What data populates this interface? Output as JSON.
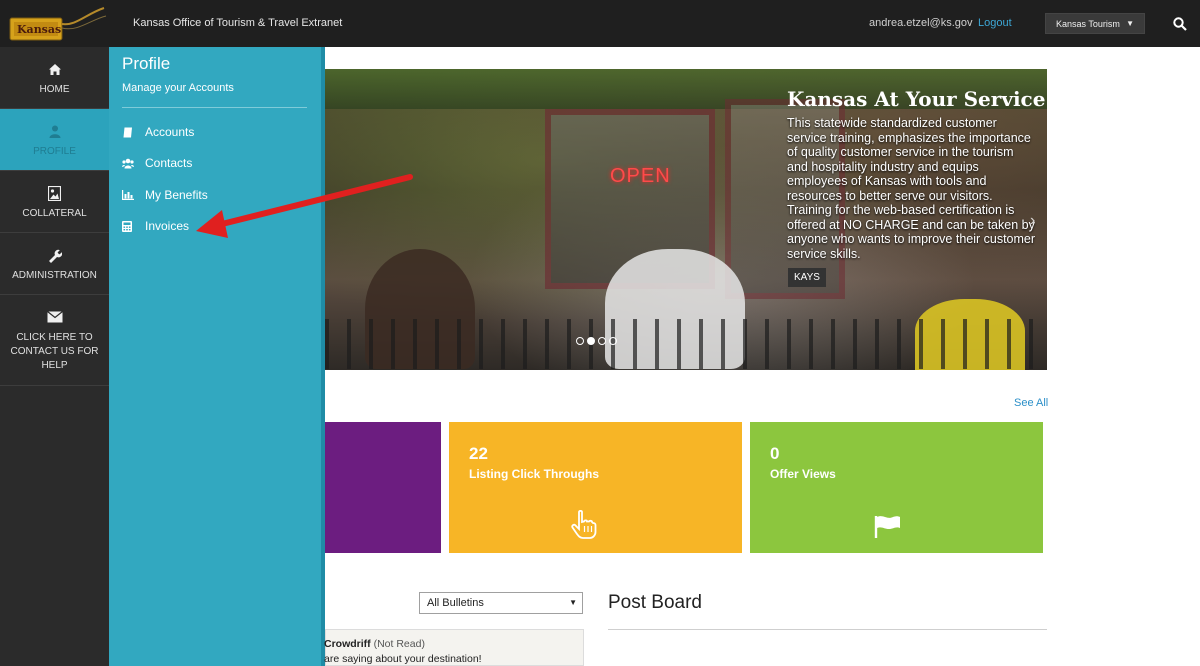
{
  "header": {
    "site_title": "Kansas Office of Tourism & Travel Extranet",
    "user_email": "andrea.etzel@ks.gov",
    "logout_label": "Logout",
    "account_selected": "Kansas Tourism",
    "logo_text": "Kansas"
  },
  "sidebar": {
    "items": [
      {
        "label": "HOME",
        "icon": "home-icon"
      },
      {
        "label": "PROFILE",
        "icon": "user-icon"
      },
      {
        "label": "COLLATERAL",
        "icon": "image-icon"
      },
      {
        "label": "ADMINISTRATION",
        "icon": "wrench-icon"
      },
      {
        "label": "CLICK HERE TO CONTACT US FOR HELP",
        "icon": "envelope-icon"
      }
    ]
  },
  "profile_panel": {
    "title": "Profile",
    "subtitle": "Manage your Accounts",
    "links": [
      {
        "label": "Accounts",
        "icon": "book-icon"
      },
      {
        "label": "Contacts",
        "icon": "users-icon"
      },
      {
        "label": "My Benefits",
        "icon": "bar-chart-icon"
      },
      {
        "label": "Invoices",
        "icon": "calculator-icon"
      }
    ]
  },
  "hero": {
    "title": "Kansas At Your Service",
    "body": "This statewide standardized customer service training, emphasizes the importance of quality customer service in the tourism and hospitality industry and equips employees of Kansas with tools and resources to better serve our visitors. Training for the web-based certification is offered at NO CHARGE and can be taken by anyone who wants to improve their customer service skills.",
    "tag": "KAYS",
    "sign_text": "OPEN",
    "slide_count": 4,
    "active_slide": 2
  },
  "stats": {
    "see_all": "See All",
    "tiles": [
      {
        "value": "22",
        "label": "Listing Click Throughs",
        "icon": "hand-pointer-icon",
        "color": "#f7b526"
      },
      {
        "value": "0",
        "label": "Offer Views",
        "icon": "flag-icon",
        "color": "#8cc63e"
      }
    ],
    "purple_tile_color": "#6c1d80"
  },
  "bulletins": {
    "filter_selected": "All Bulletins",
    "item_source": "Crowdriff",
    "item_state": "(Not Read)",
    "item_text": "are saying about your destination!"
  },
  "post_board": {
    "title": "Post Board"
  },
  "colors": {
    "panel": "#32a8c0",
    "topbar": "#1f1f1f",
    "sidebar": "#2b2b2b",
    "arrow": "#e0201f"
  }
}
